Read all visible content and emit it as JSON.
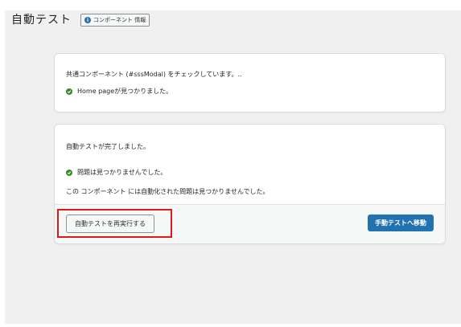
{
  "header": {
    "title": "自動テスト",
    "info_button_label": "コンポーネント 情報"
  },
  "card1": {
    "checking_text": "共通コンポーネント (#sssModal) をチェックしています。..",
    "found_text": "Home pageが見つかりました。"
  },
  "card2": {
    "complete_text": "自動テストが完了しました。",
    "no_issues_text": "問題は見つかりませんでした。",
    "no_auto_issues_text": "この コンポーネント には自動化された問題は見つかりませんでした。",
    "rerun_button": "自動テストを再実行する",
    "manual_button": "手動テストへ移動"
  },
  "colors": {
    "success": "#3c8a2e",
    "primary": "#2271b1",
    "highlight": "#e01818"
  }
}
